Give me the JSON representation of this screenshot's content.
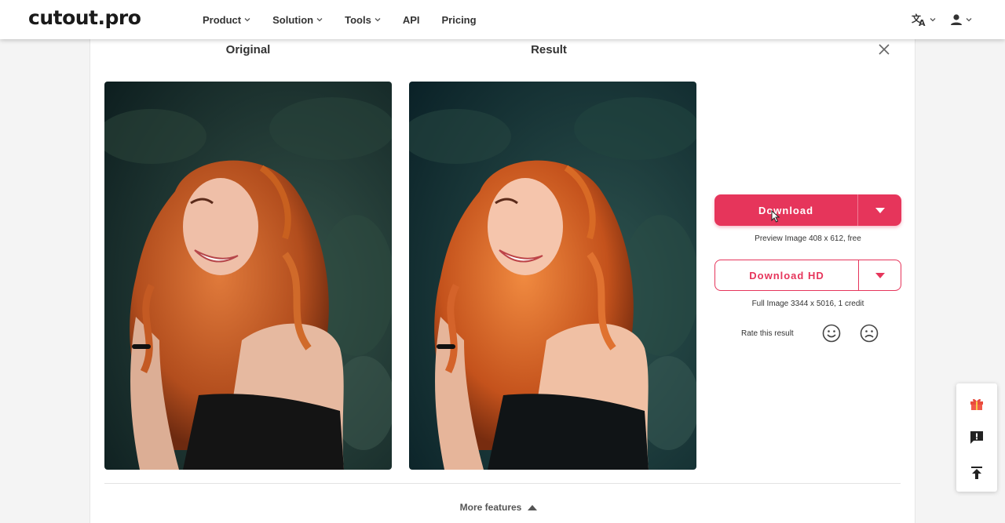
{
  "brand": {
    "logo_text": "cutout.pro"
  },
  "nav": {
    "items": [
      {
        "label": "Product",
        "has_dropdown": true
      },
      {
        "label": "Solution",
        "has_dropdown": true
      },
      {
        "label": "Tools",
        "has_dropdown": true
      },
      {
        "label": "API",
        "has_dropdown": false
      },
      {
        "label": "Pricing",
        "has_dropdown": false
      }
    ],
    "right_icons": [
      "translate-icon",
      "user-icon"
    ]
  },
  "result": {
    "original_title": "Original",
    "result_title": "Result"
  },
  "download": {
    "label": "Download",
    "note": "Preview Image 408 x 612, free"
  },
  "download_hd": {
    "label": "Download HD",
    "note": "Full Image 3344 x 5016, 1 credit"
  },
  "rating": {
    "label": "Rate this result"
  },
  "more_features": {
    "label": "More features"
  },
  "colors": {
    "accent": "#e6355b",
    "panel": "#ffffff",
    "page_bg": "#f4f4f4"
  },
  "float_icons": [
    "gift-icon",
    "feedback-icon",
    "back-to-top-icon"
  ]
}
